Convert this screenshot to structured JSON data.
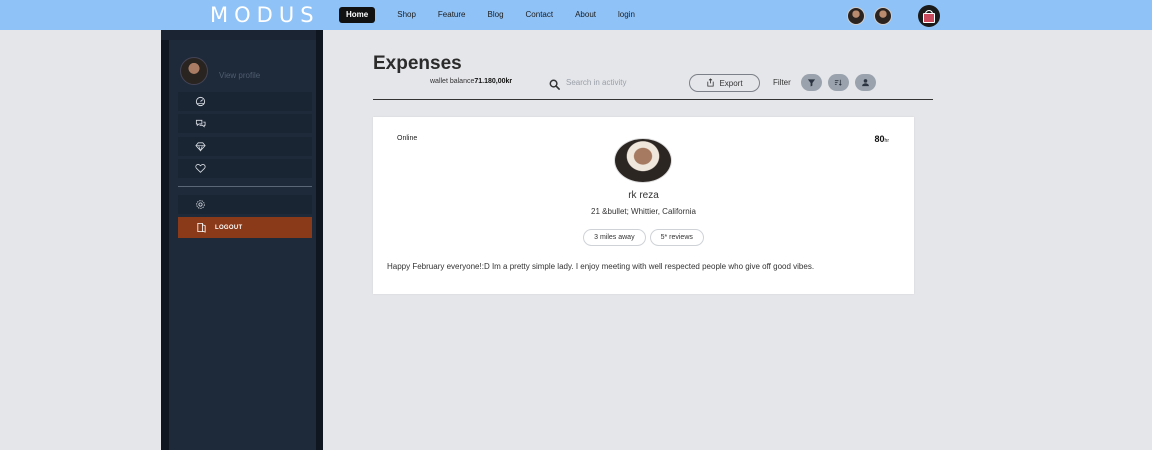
{
  "brand": {
    "logo": "MODUS"
  },
  "nav": {
    "items": [
      {
        "label": "Home",
        "active": true
      },
      {
        "label": "Shop"
      },
      {
        "label": "Feature"
      },
      {
        "label": "Blog"
      },
      {
        "label": "Contact"
      },
      {
        "label": "About"
      },
      {
        "label": "login"
      }
    ]
  },
  "sidebar": {
    "view_profile": "View profile",
    "items": [
      {
        "icon": "dashboard-icon"
      },
      {
        "icon": "chat-icon"
      },
      {
        "icon": "gem-icon"
      },
      {
        "icon": "heart-icon"
      },
      {
        "icon": "settings-icon"
      }
    ],
    "logout": {
      "label": "LOGOUT",
      "icon": "logout-icon",
      "color": "#8a3a18"
    }
  },
  "header": {
    "title": "Expenses",
    "wallet_label": "wallet balance",
    "wallet_value": "71.180,00kr",
    "search_placeholder": "Search in activity",
    "export_label": "Export",
    "filter_label": "Filter"
  },
  "card": {
    "status": "Online",
    "distance_value": "80",
    "distance_unit": "hr",
    "name": "rk reza",
    "meta": "21  &bullet;  Whittier, California",
    "chips": [
      "3 miles away",
      "5* reviews"
    ],
    "bio": "Happy February everyone!:D Im a pretty simple lady. I enjoy meeting with well respected people who give off good vibes."
  },
  "colors": {
    "topbar": "#8fc2f7",
    "sidebar": "#1e2a3a",
    "logout": "#8a3a18",
    "background": "#e5e6ea"
  }
}
